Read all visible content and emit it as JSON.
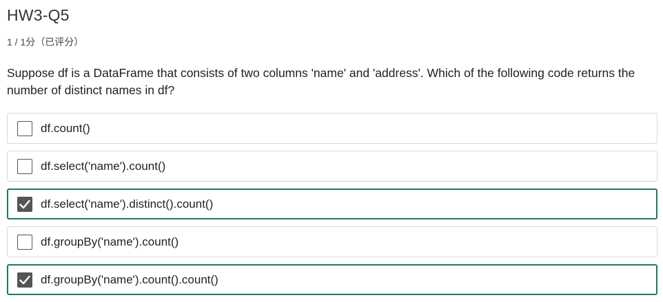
{
  "quiz": {
    "title": "HW3-Q5",
    "score": "1 / 1分（已评分）",
    "question": "Suppose df is a DataFrame that consists of two columns 'name' and 'address'. Which of the following code returns the number of distinct names in df?",
    "options": [
      {
        "label": "df.count()",
        "checked": false
      },
      {
        "label": "df.select('name').count()",
        "checked": false
      },
      {
        "label": "df.select('name').distinct().count()",
        "checked": true
      },
      {
        "label": "df.groupBy('name').count()",
        "checked": false
      },
      {
        "label": "df.groupBy('name').count().count()",
        "checked": true
      }
    ]
  },
  "colors": {
    "selected_border": "#1f7a4f",
    "checkbox_fill": "#555555"
  }
}
